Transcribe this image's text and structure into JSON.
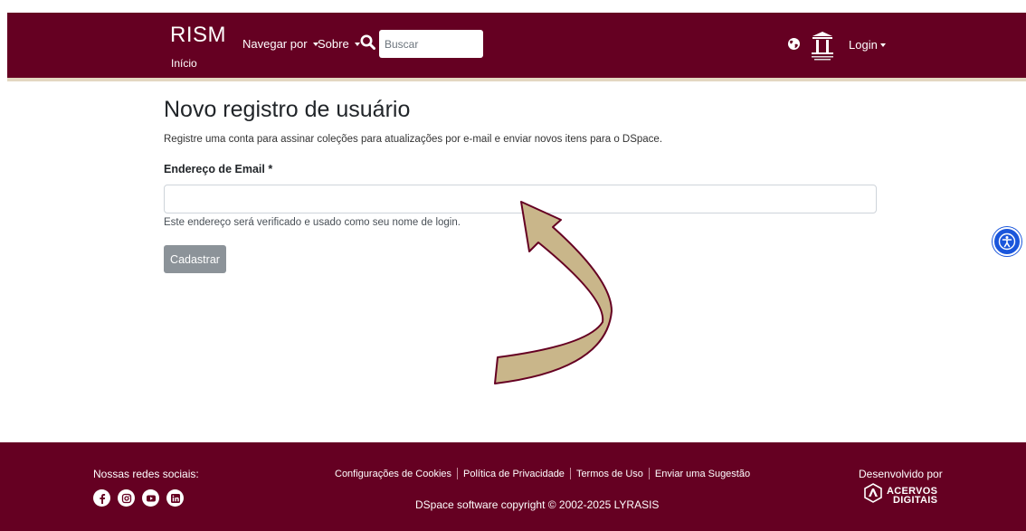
{
  "header": {
    "brand": "RISM",
    "brand_sub": "Início",
    "nav": {
      "browse_label": "Navegar por",
      "about_label": "Sobre"
    },
    "search": {
      "placeholder": "Buscar"
    },
    "login_label": "Login"
  },
  "main": {
    "title": "Novo registro de usuário",
    "intro": "Registre uma conta para assinar coleções para atualizações por e-mail e enviar novos itens para o DSpace.",
    "email_label": "Endereço de Email *",
    "email_value": "",
    "email_hint": "Este endereço será verificado e usado como seu nome de login.",
    "submit_label": "Cadastrar"
  },
  "footer": {
    "social_title": "Nossas redes sociais:",
    "social_icons": [
      "facebook-icon",
      "instagram-icon",
      "youtube-icon",
      "linkedin-icon"
    ],
    "links": [
      "Configurações de Cookies",
      "Política de Privacidade",
      "Termos de Uso",
      "Enviar uma Sugestão"
    ],
    "copyright": "DSpace software copyright © 2002-2025 LYRASIS",
    "developed_by": "Desenvolvido por",
    "dev_logo_line1": "ACERVOS",
    "dev_logo_line2": "DIGITAIS"
  },
  "colors": {
    "brand": "#650022",
    "header_rule": "#e3d7c1",
    "button": "#8c9399",
    "arrow_fill": "#c9b68a",
    "accessibility": "#1a56db"
  }
}
